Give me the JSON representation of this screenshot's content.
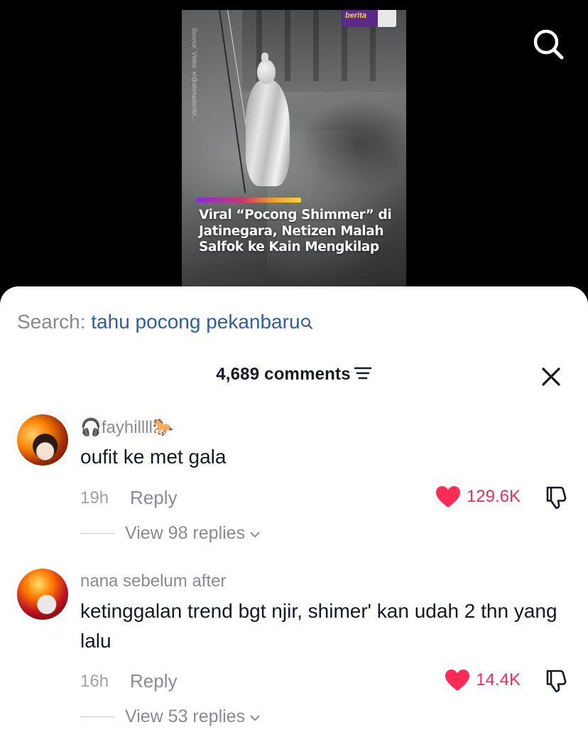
{
  "video": {
    "source_caption": "Source: Video: x/@ahmadsmbi...",
    "brand": "berita",
    "headline": "Viral “Pocong Shimmer” di Jatinegara, Netizen Malah Salfok ke Kain Mengkilap",
    "headline_bar_colors": [
      "#8a2be2",
      "#d1356b",
      "#f5a623",
      "#f7d13a"
    ]
  },
  "top_bar": {
    "search_icon": "search-icon"
  },
  "search_suggestion": {
    "label": "Search:",
    "term": "tahu pocong pekanbaru",
    "icon": "search-icon",
    "term_color": "#2e5ea9"
  },
  "comments_header": {
    "count_label": "4,689 comments",
    "filter_icon": "filter-icon",
    "close_icon": "close-icon"
  },
  "comments": [
    {
      "username": "🎧fayhillll🐎",
      "text": "oufit ke met gala",
      "time": "19h",
      "reply_label": "Reply",
      "likes": "129.6K",
      "view_replies": "View 98 replies"
    },
    {
      "username": "nana sebelum after",
      "text": "ketinggalan trend bgt njir, shimer' kan udah 2 thn yang lalu",
      "time": "16h",
      "reply_label": "Reply",
      "likes": "14.4K",
      "view_replies": "View 53 replies"
    }
  ],
  "colors": {
    "like": "#fe2c55",
    "text_primary": "#161823",
    "text_secondary": "#8a8b91"
  }
}
